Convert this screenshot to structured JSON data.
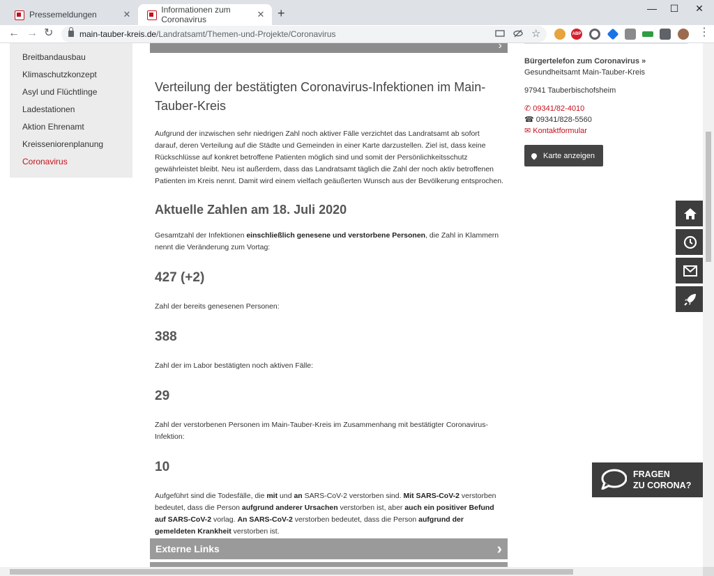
{
  "browser": {
    "tabs": [
      {
        "title": "Pressemeldungen",
        "active": false
      },
      {
        "title": "Informationen zum Coronavirus",
        "active": true
      }
    ],
    "url_host": "main-tauber-kreis.de",
    "url_path": "/Landratsamt/Themen-und-Projekte/Coronavirus",
    "close_glyph": "✕",
    "new_tab_glyph": "+",
    "minimize_glyph": "—",
    "maximize_glyph": "☐",
    "window_close_glyph": "✕",
    "back_glyph": "←",
    "forward_glyph": "→",
    "reload_glyph": "↻",
    "star_glyph": "☆",
    "abp_label": "ABP"
  },
  "sidebar": {
    "items": [
      {
        "label": "Breitbandausbau",
        "active": false
      },
      {
        "label": "Klimaschutzkonzept",
        "active": false
      },
      {
        "label": "Asyl und Flüchtlinge",
        "active": false
      },
      {
        "label": "Ladestationen",
        "active": false
      },
      {
        "label": "Aktion Ehrenamt",
        "active": false
      },
      {
        "label": "Kreisseniorenplanung",
        "active": false
      },
      {
        "label": "Coronavirus",
        "active": true
      }
    ]
  },
  "main": {
    "heading": "Verteilung der bestätigten Coronavirus-Infektionen im Main-Tauber-Kreis",
    "intro": "Aufgrund der inzwischen sehr niedrigen Zahl noch aktiver Fälle verzichtet das Landratsamt ab sofort darauf, deren Verteilung auf die Städte und Gemeinden in einer Karte darzustellen. Ziel ist, dass keine Rückschlüsse auf konkret betroffene Patienten möglich sind und somit der Persönlichkeitsschutz gewährleistet bleibt. Neu ist außerdem, dass das Landratsamt täglich die Zahl der noch aktiv betroffenen Patienten im Kreis nennt. Damit wird einem vielfach geäußerten Wunsch aus der Bevölkerung entsprochen.",
    "subheading": "Aktuelle Zahlen am 18. Juli 2020",
    "total_text_pre": "Gesamtzahl der Infektionen ",
    "total_text_bold": "einschließlich genesene und verstorbene Personen",
    "total_text_post": ", die Zahl in Klammern nennt die Veränderung zum Vortag:",
    "total_value": "427 (+2)",
    "recovered_label": "Zahl der bereits genesenen Personen:",
    "recovered_value": "388",
    "active_label": "Zahl der im Labor bestätigten noch aktiven Fälle:",
    "active_value": "29",
    "deaths_label": "Zahl der verstorbenen Personen im Main-Tauber-Kreis im Zusammenhang mit bestätigter Coronavirus-Infektion:",
    "deaths_value": "10",
    "note": {
      "t1": "Aufgeführt sind die Todesfälle, die ",
      "b1": "mit",
      "t2": " und ",
      "b2": "an",
      "t3": " SARS-CoV-2 verstorben sind. ",
      "b3": "Mit SARS-CoV-2",
      "t4": " verstorben bedeutet, dass die Person ",
      "b4": "aufgrund anderer Ursachen",
      "t5": " verstorben ist, aber ",
      "b5": "auch ein positiver Befund auf SARS-CoV-2",
      "t6": " vorlag. ",
      "b6": "An SARS-CoV-2",
      "t7": " verstorben bedeutet, dass die Person ",
      "b7": "aufgrund der gemeldeten Krankheit",
      "t8": " verstorben ist."
    },
    "external_links_label": "Externe Links"
  },
  "right": {
    "hotline_title": "Bürgertelefon zum Coronavirus »",
    "org": "Gesundheitsamt Main-Tauber-Kreis",
    "city": "97941 Tauberbischofsheim",
    "phone": "09341/82-4010",
    "fax": "09341/828-5560",
    "contact": "Kontaktformular",
    "map_button": "Karte anzeigen"
  },
  "floating": {
    "buttons": [
      "home-icon",
      "clock-icon",
      "mail-icon",
      "rocket-icon"
    ],
    "fragen_line1": "FRAGEN",
    "fragen_line2": "ZU CORONA?"
  },
  "colors": {
    "accent_red": "#c4111b",
    "dark_button": "#3d3d3d",
    "bar_gray": "#9a9a9a"
  }
}
